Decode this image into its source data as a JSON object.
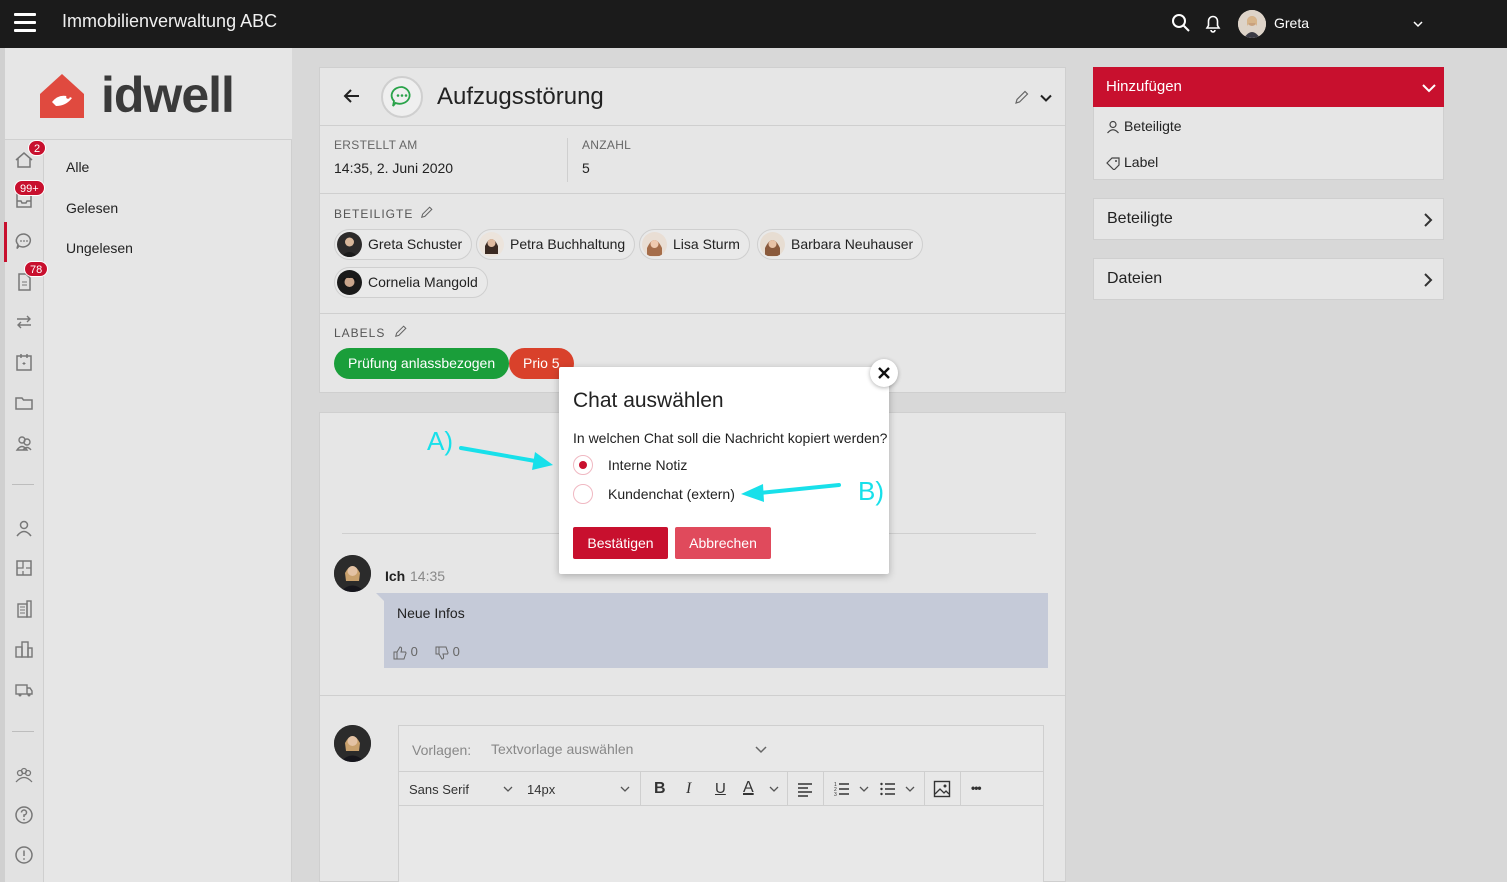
{
  "app": {
    "title": "Immobilienverwaltung ABC",
    "user": "Greta",
    "brand": "idwell"
  },
  "colors": {
    "accent": "#c8102e",
    "label_green": "#1a9e3a",
    "label_red": "#d9412b",
    "annotation": "#18e0ea"
  },
  "rail": {
    "badges": {
      "home": "2",
      "inbox": "99+",
      "documents": "78"
    }
  },
  "nav": {
    "items": [
      "Alle",
      "Gelesen",
      "Ungelesen"
    ]
  },
  "ticket": {
    "title": "Aufzugsstörung",
    "created_label": "ERSTELLT AM",
    "created_value": "14:35, 2. Juni 2020",
    "count_label": "ANZAHL",
    "count_value": "5",
    "participants_label": "BETEILIGTE",
    "participants": [
      "Greta Schuster",
      "Petra Buchhaltung",
      "Lisa Sturm",
      "Barbara Neuhauser",
      "Cornelia Mangold"
    ],
    "labels_label": "LABELS",
    "labels": [
      "Prüfung anlassbezogen",
      "Prio 5"
    ]
  },
  "chat": {
    "author": "Ich",
    "time": "14:35",
    "message": "Neue Infos",
    "likes": "0",
    "dislikes": "0"
  },
  "editor": {
    "templates_label": "Vorlagen:",
    "templates_placeholder": "Textvorlage auswählen",
    "font": "Sans Serif",
    "size": "14px",
    "bold": "B",
    "italic": "I",
    "underline": "U",
    "color": "A",
    "more": "•••"
  },
  "right_panel": {
    "add_title": "Hinzufügen",
    "add_items": [
      "Beteiligte",
      "Label"
    ],
    "boxes": [
      "Beteiligte",
      "Dateien"
    ]
  },
  "modal": {
    "title": "Chat auswählen",
    "question": "In welchen Chat soll die Nachricht kopiert werden?",
    "options": [
      "Interne Notiz",
      "Kundenchat (extern)"
    ],
    "selected": "Interne Notiz",
    "confirm": "Bestätigen",
    "cancel": "Abbrechen"
  },
  "annotations": {
    "a": "A)",
    "b": "B)"
  }
}
